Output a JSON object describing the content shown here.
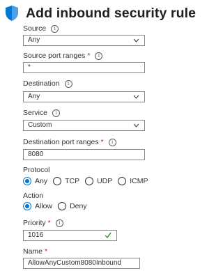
{
  "header": {
    "title": "Add inbound security rule"
  },
  "source": {
    "label": "Source",
    "value": "Any"
  },
  "source_port": {
    "label": "Source port ranges",
    "required": "*",
    "value": "*"
  },
  "destination": {
    "label": "Destination",
    "value": "Any"
  },
  "service": {
    "label": "Service",
    "value": "Custom"
  },
  "dest_port": {
    "label": "Destination port ranges",
    "required": "*",
    "value": "8080"
  },
  "protocol": {
    "label": "Protocol",
    "options": [
      "Any",
      "TCP",
      "UDP",
      "ICMP"
    ],
    "selected": "Any"
  },
  "action": {
    "label": "Action",
    "options": [
      "Allow",
      "Deny"
    ],
    "selected": "Allow"
  },
  "priority": {
    "label": "Priority",
    "required": "*",
    "value": "1016"
  },
  "name": {
    "label": "Name",
    "required": "*",
    "value": "AllowAnyCustom8080Inbound"
  },
  "colors": {
    "accent": "#0078d4",
    "required": "#a4262c",
    "valid": "#107c10"
  },
  "icons": {
    "info": "info-icon",
    "chevron": "chevron-down-icon",
    "check": "checkmark-icon",
    "shield": "shield-icon"
  }
}
